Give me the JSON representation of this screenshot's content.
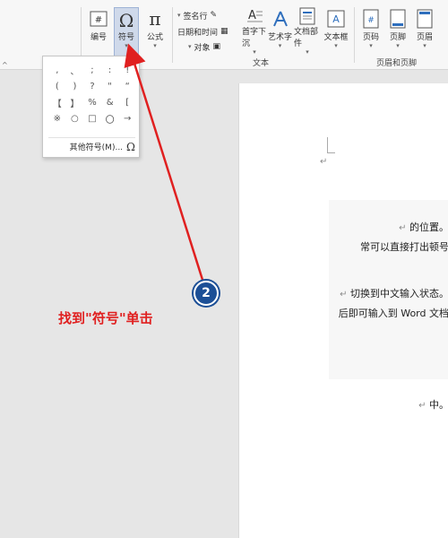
{
  "ribbon": {
    "buttons": {
      "cover": "页眉",
      "footer": "页脚",
      "page_number": "页码",
      "textbox": "文本框",
      "doc_parts": "文档部件",
      "wordart": "艺术字",
      "drop_cap": "首字下沉",
      "signature_line": "签名行",
      "date_time": "日期和时间",
      "object": "对象",
      "formula": "公式",
      "symbol": "符号",
      "number": "编号"
    },
    "groups": {
      "header_footer": "页眉和页脚",
      "text": "文本"
    }
  },
  "symbol_panel": {
    "symbols": [
      ",",
      "、",
      ";",
      ":",
      "!",
      "(",
      ")",
      "?",
      "\"",
      "“",
      "【",
      "】",
      "%",
      "&",
      "[",
      "※",
      "○",
      "□",
      "〇",
      "→"
    ],
    "more_label": "其他符号(M)..."
  },
  "document": {
    "lines": [
      "的位置。",
      "常可以直接打出顿号",
      "切换到中文输入状态。",
      "后即可输入到 Word 文档",
      "中。"
    ],
    "para_mark": "↵"
  },
  "annotation": {
    "step_number": "2",
    "instruction": "找到\"符号\"单击",
    "arrow_color": "#e02020",
    "badge_color": "#1c4f96"
  }
}
